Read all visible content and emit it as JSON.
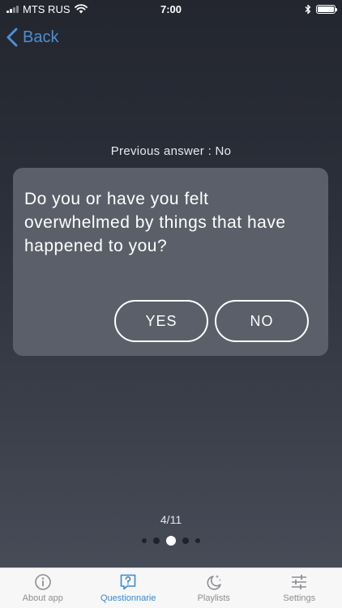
{
  "status_bar": {
    "carrier": "MTS RUS",
    "time": "7:00"
  },
  "nav": {
    "back_label": "Back"
  },
  "question": {
    "previous_answer": "Previous answer : No",
    "text": "Do you or have you felt overwhelmed by things that have happened to you?",
    "yes_label": "YES",
    "no_label": "NO"
  },
  "progress": {
    "label": "4/11",
    "dots_total": 5,
    "dots_active": 3
  },
  "tabs": [
    {
      "label": "About app",
      "icon": "info-icon",
      "active": false
    },
    {
      "label": "Questionnarie",
      "icon": "question-bubble-icon",
      "active": true
    },
    {
      "label": "Playlists",
      "icon": "moon-stars-icon",
      "active": false
    },
    {
      "label": "Settings",
      "icon": "sliders-icon",
      "active": false
    }
  ],
  "colors": {
    "accent": "#3a86d4",
    "card": "#5b5f69",
    "tab_inactive": "#8e8e93"
  }
}
